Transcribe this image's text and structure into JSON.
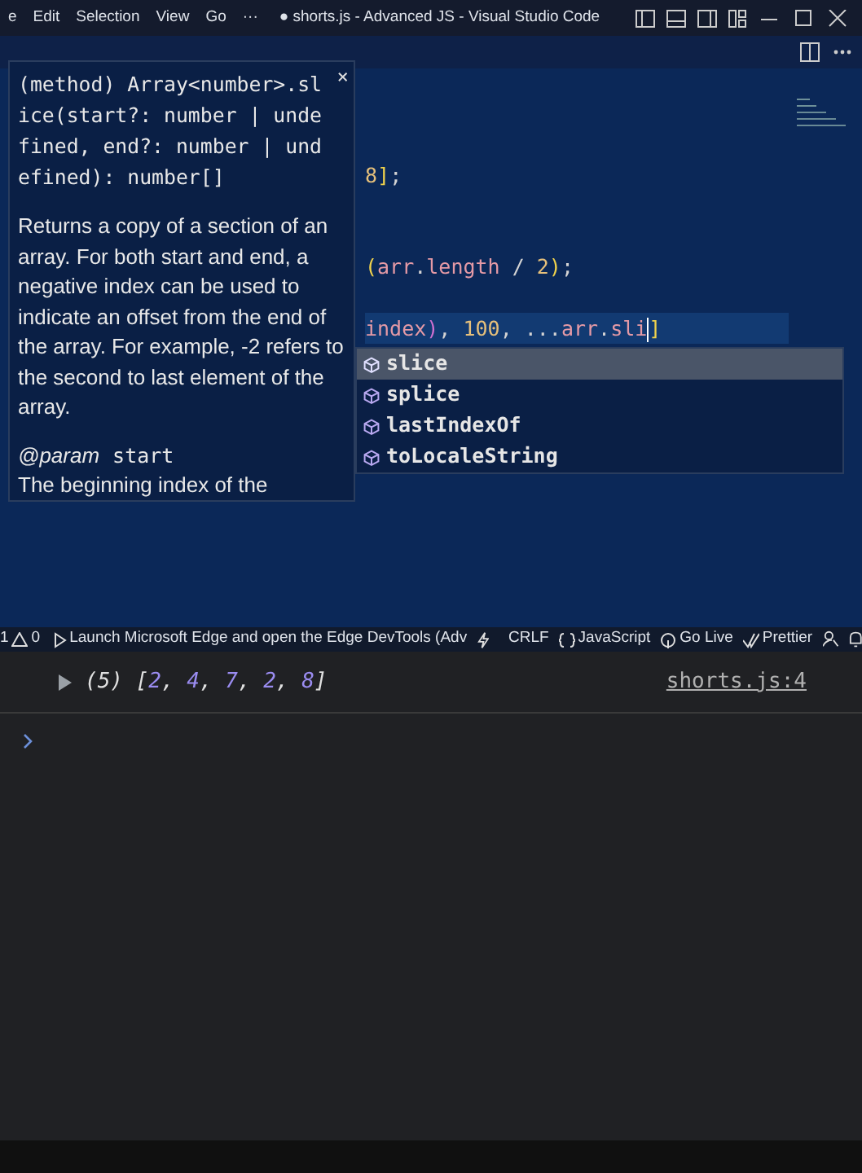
{
  "title_bar": {
    "menu": [
      "e",
      "Edit",
      "Selection",
      "View",
      "Go",
      "···"
    ],
    "title": "● shorts.js - Advanced JS - Visual Studio Code"
  },
  "editor": {
    "code_lines": [
      {
        "highlighted": false,
        "tokens": [
          {
            "kind": "number",
            "text": "8"
          },
          {
            "kind": "bracket",
            "text": "]"
          },
          {
            "kind": "punct",
            "text": ";"
          }
        ]
      },
      {
        "highlighted": false,
        "tokens": [
          {
            "kind": "bracket",
            "text": "("
          },
          {
            "kind": "ident",
            "text": "arr"
          },
          {
            "kind": "punct",
            "text": "."
          },
          {
            "kind": "ident",
            "text": "length"
          },
          {
            "kind": "punct",
            "text": " / "
          },
          {
            "kind": "number",
            "text": "2"
          },
          {
            "kind": "bracket",
            "text": ")"
          },
          {
            "kind": "punct",
            "text": ";"
          }
        ]
      },
      {
        "highlighted": true,
        "tokens": [
          {
            "kind": "ident",
            "text": "index"
          },
          {
            "kind": "bracket2",
            "text": ")"
          },
          {
            "kind": "punct",
            "text": ", "
          },
          {
            "kind": "number",
            "text": "100"
          },
          {
            "kind": "punct",
            "text": ", ..."
          },
          {
            "kind": "ident",
            "text": "arr"
          },
          {
            "kind": "punct",
            "text": "."
          },
          {
            "kind": "ident",
            "text": "sli",
            "caret_after": true
          },
          {
            "kind": "bracket",
            "text": "]"
          }
        ]
      }
    ],
    "hover": {
      "close": "×",
      "signature": "(method) Array<number>.slice(start?: number | undefined, end?: number | undefined): number[]",
      "description": "Returns a copy of a section of an array. For both start and end, a negative index can be used to indicate an offset from the end of the array. For example, -2 refers to the second to last element of the array.",
      "param_tag": "@param",
      "param_name": "start",
      "param_description": "The beginning index of the"
    },
    "suggestions": [
      {
        "label": "slice",
        "selected": true
      },
      {
        "label": "splice",
        "selected": false
      },
      {
        "label": "lastIndexOf",
        "selected": false
      },
      {
        "label": "toLocaleString",
        "selected": false
      }
    ]
  },
  "status_bar": {
    "errors": "1",
    "warnings": "0",
    "launch": "Launch Microsoft Edge and open the Edge DevTools (Adv",
    "items": [
      "CRLF",
      "JavaScript",
      "Go Live",
      "Prettier"
    ]
  },
  "console": {
    "entries": [
      {
        "count": "(5)",
        "tokens": [
          {
            "kind": "punct",
            "text": " ["
          },
          {
            "kind": "num",
            "text": "2"
          },
          {
            "kind": "punct",
            "text": ", "
          },
          {
            "kind": "num",
            "text": "4"
          },
          {
            "kind": "punct",
            "text": ", "
          },
          {
            "kind": "num",
            "text": "7"
          },
          {
            "kind": "punct",
            "text": ", "
          },
          {
            "kind": "num",
            "text": "2"
          },
          {
            "kind": "punct",
            "text": ", "
          },
          {
            "kind": "num",
            "text": "8"
          },
          {
            "kind": "punct",
            "text": "]"
          }
        ],
        "source": "shorts.js:4"
      }
    ]
  }
}
